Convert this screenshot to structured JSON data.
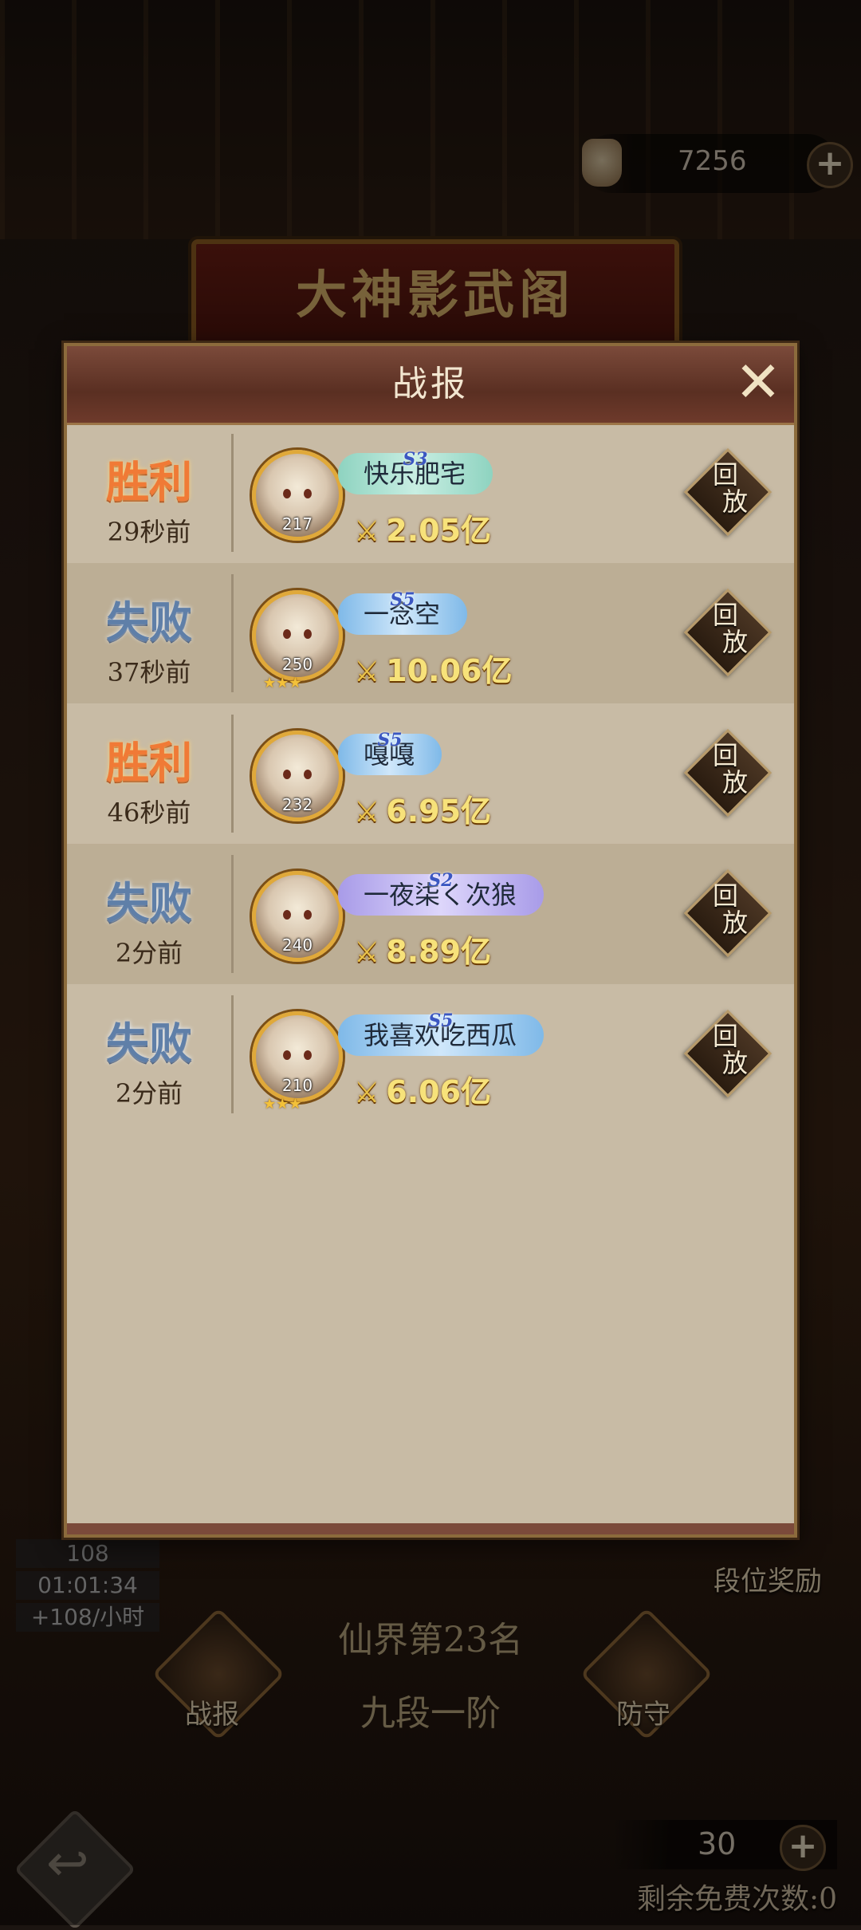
{
  "background": {
    "banner_title": "大神影武阁",
    "currency_value": "7256",
    "timer": {
      "line1": "108",
      "line2": "01:01:34",
      "line3": "+108/小时"
    },
    "rank_reward_label": "段位奖励",
    "rank_text": "仙界第23名",
    "tier_text": "九段一阶",
    "battle_report_label": "战报",
    "defense_label": "防守",
    "tickets_value": "30",
    "free_attempts": "剩余免费次数:0"
  },
  "modal": {
    "title": "战报",
    "replay_label_1": "回",
    "replay_label_2": "放",
    "rows": [
      {
        "result": "胜利",
        "outcome": "win",
        "time_ago": "29秒前",
        "level": "217",
        "season": "S3",
        "plate": "s3",
        "name": "快乐肥宅",
        "power": "2.05亿",
        "stars": ""
      },
      {
        "result": "失败",
        "outcome": "lose",
        "time_ago": "37秒前",
        "level": "250",
        "season": "S5",
        "plate": "s5",
        "name": "一念空",
        "power": "10.06亿",
        "stars": "★★★"
      },
      {
        "result": "胜利",
        "outcome": "win",
        "time_ago": "46秒前",
        "level": "232",
        "season": "S5",
        "plate": "s5",
        "name": "嘎嘎",
        "power": "6.95亿",
        "stars": ""
      },
      {
        "result": "失败",
        "outcome": "lose",
        "time_ago": "2分前",
        "level": "240",
        "season": "S2",
        "plate": "s2",
        "name": "一夜柒く次狼",
        "power": "8.89亿",
        "stars": ""
      },
      {
        "result": "失败",
        "outcome": "lose",
        "time_ago": "2分前",
        "level": "210",
        "season": "S5",
        "plate": "s5",
        "name": "我喜欢吃西瓜",
        "power": "6.06亿",
        "stars": "★★★"
      }
    ]
  }
}
